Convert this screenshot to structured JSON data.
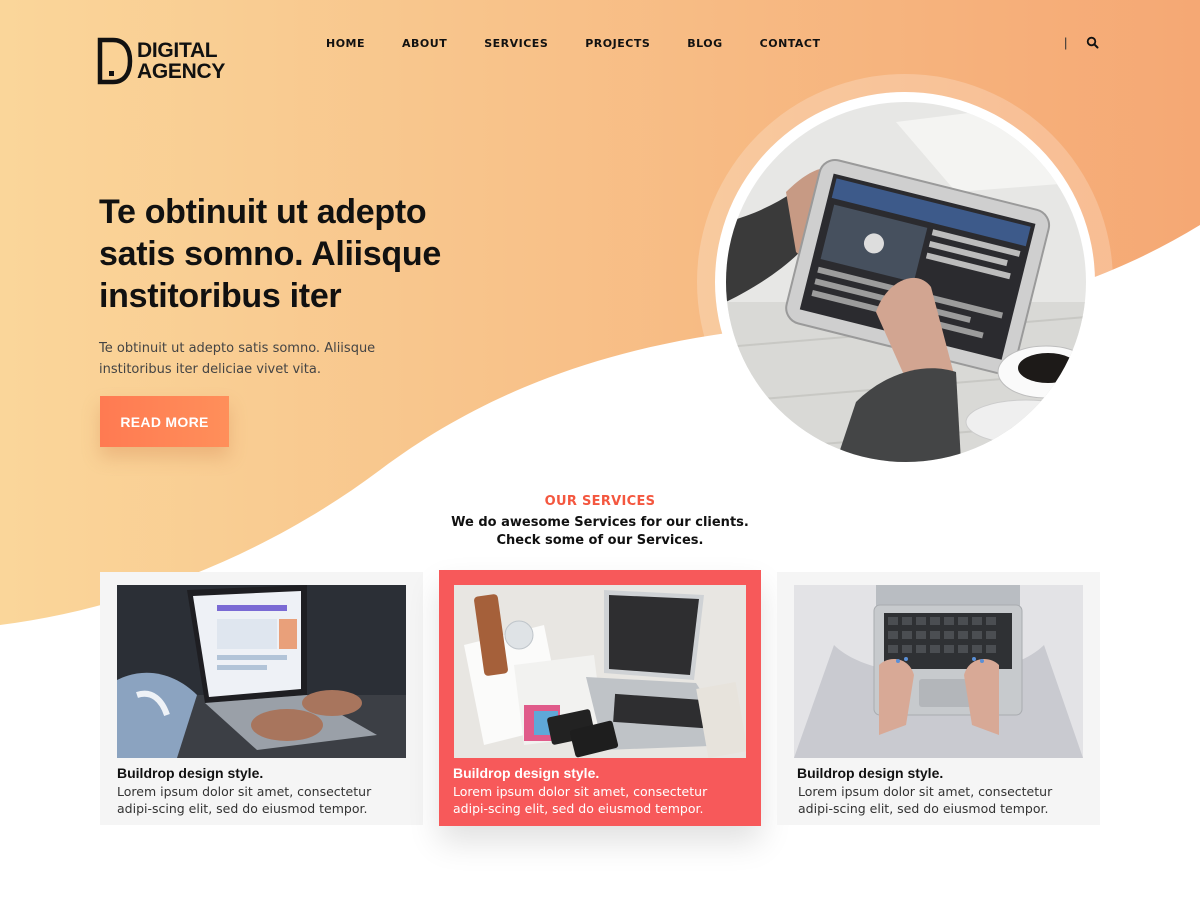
{
  "brand": {
    "line1": "DIGITAL",
    "line2": "AGENCY"
  },
  "nav": {
    "items": [
      "HOME",
      "ABOUT",
      "SERVICES",
      "PROJECTS",
      "BLOG",
      "CONTACT"
    ],
    "divider": "|",
    "search_icon": "search-icon"
  },
  "hero": {
    "title": "Te obtinuit ut adepto satis somno. Aliisque institoribus iter",
    "subtitle": "Te obtinuit ut adepto satis somno. Aliisque institoribus iter deliciae vivet vita.",
    "cta_label": "READ MORE"
  },
  "services": {
    "kicker": "OUR SERVICES",
    "heading_line1": "We do awesome Services for our clients.",
    "heading_line2": "Check some of our Services.",
    "cards": [
      {
        "title": "Buildrop design style.",
        "text": "Lorem ipsum dolor sit amet, consectetur adipi-scing elit, sed do eiusmod tempor."
      },
      {
        "title": "Buildrop design style.",
        "text": "Lorem ipsum dolor sit amet, consectetur adipi-scing elit, sed do eiusmod tempor."
      },
      {
        "title": "Buildrop design style.",
        "text": "Lorem ipsum dolor sit amet, consectetur adipi-scing elit, sed do eiusmod tempor."
      }
    ]
  },
  "colors": {
    "gradient_start": "#fad69a",
    "gradient_end": "#f5a874",
    "accent": "#f7595a",
    "cta": "#ff7a52",
    "kicker": "#f4573f"
  }
}
